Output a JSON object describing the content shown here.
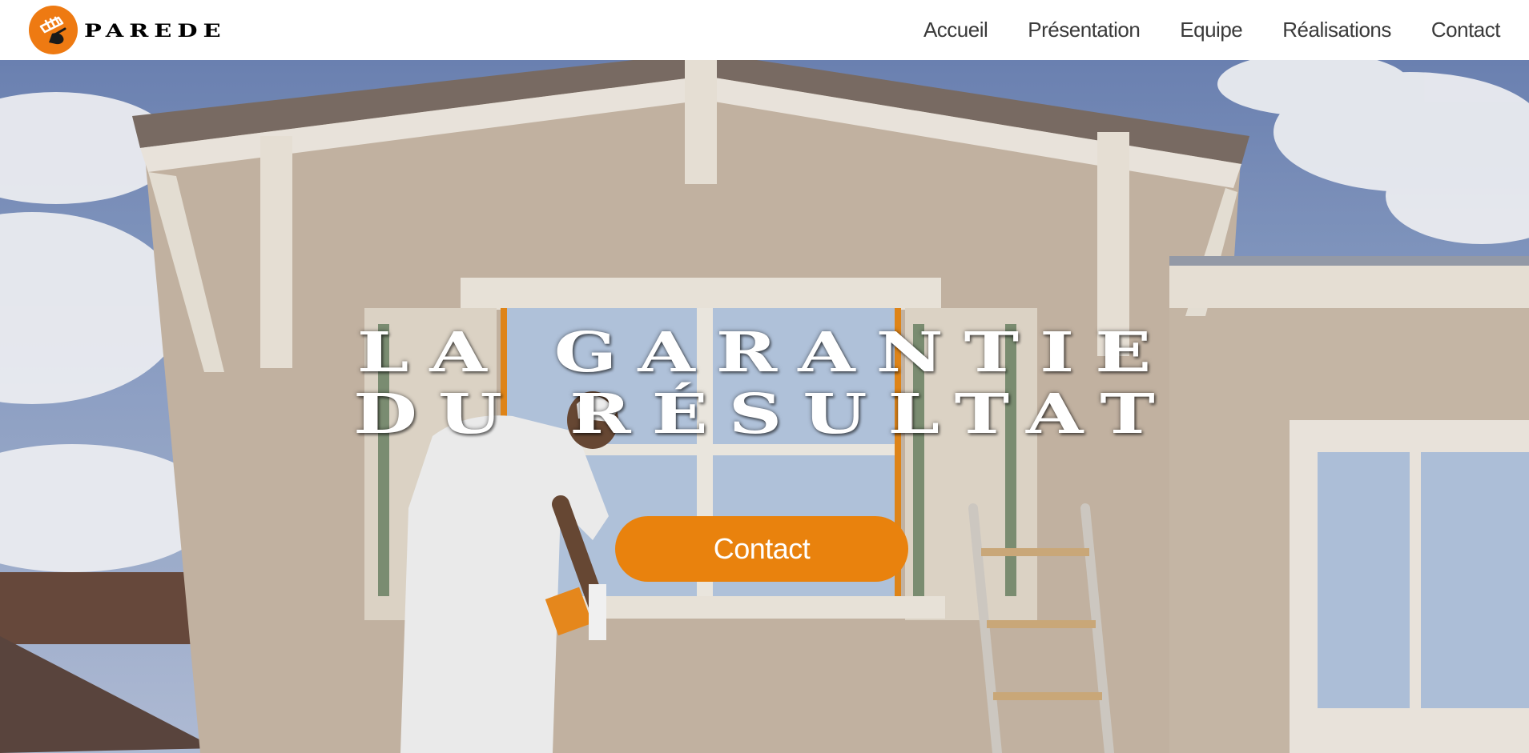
{
  "brand": {
    "name": "PAREDE",
    "logo_color": "#ee7a12"
  },
  "nav": {
    "items": [
      {
        "label": "Accueil"
      },
      {
        "label": "Présentation"
      },
      {
        "label": "Equipe"
      },
      {
        "label": "Réalisations"
      },
      {
        "label": "Contact"
      }
    ]
  },
  "hero": {
    "headline_line1": "LA GARANTIE",
    "headline_line2": "DU RÉSULTAT",
    "cta_label": "Contact",
    "cta_color": "#e9820d"
  }
}
